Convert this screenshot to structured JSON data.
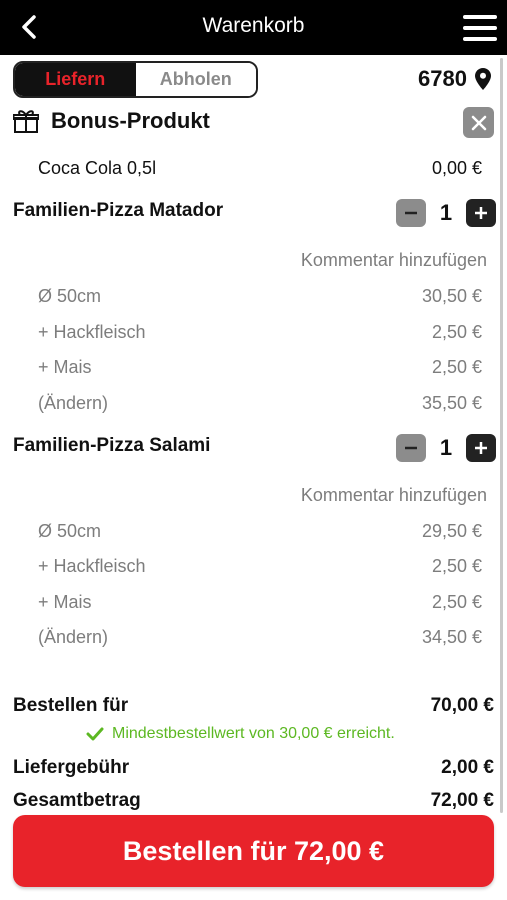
{
  "header": {
    "title": "Warenkorb",
    "back_icon": "chevron-left-icon",
    "menu_icon": "hamburger-menu-icon"
  },
  "delivery_mode": {
    "options": [
      "Liefern",
      "Abholen"
    ],
    "selected": "Liefern"
  },
  "location": {
    "zip": "6780",
    "icon": "map-pin-icon"
  },
  "bonus": {
    "title": "Bonus-Produkt",
    "icon": "gift-icon",
    "item": {
      "name": "Coca Cola 0,5l",
      "price": "0,00 €"
    }
  },
  "items": [
    {
      "name": "Familien-Pizza Matador",
      "quantity": "1",
      "comment_link": "Kommentar hinzufügen",
      "lines": [
        {
          "label": "Ø 50cm",
          "price": "30,50 €"
        },
        {
          "label": "+ Hackfleisch",
          "price": "2,50 €"
        },
        {
          "label": "+ Mais",
          "price": "2,50 €"
        },
        {
          "label": "(Ändern)",
          "price": "35,50 €"
        }
      ]
    },
    {
      "name": "Familien-Pizza Salami",
      "quantity": "1",
      "comment_link": "Kommentar hinzufügen",
      "lines": [
        {
          "label": "Ø 50cm",
          "price": "29,50 €"
        },
        {
          "label": "+ Hackfleisch",
          "price": "2,50 €"
        },
        {
          "label": "+ Mais",
          "price": "2,50 €"
        },
        {
          "label": "(Ändern)",
          "price": "34,50 €"
        }
      ]
    }
  ],
  "summary": {
    "subtotal_label": "Bestellen für",
    "subtotal": "70,00 €",
    "min_order_note": "Mindestbestellwert von 30,00 € erreicht.",
    "delivery_fee_label": "Liefergebühr",
    "delivery_fee": "2,00 €",
    "total_label": "Gesamtbetrag",
    "total": "72,00 €"
  },
  "order_button": {
    "label": "Bestellen für 72,00 €"
  },
  "colors": {
    "accent": "#e8232a",
    "success": "#5cb822",
    "header_bg": "#000000"
  }
}
